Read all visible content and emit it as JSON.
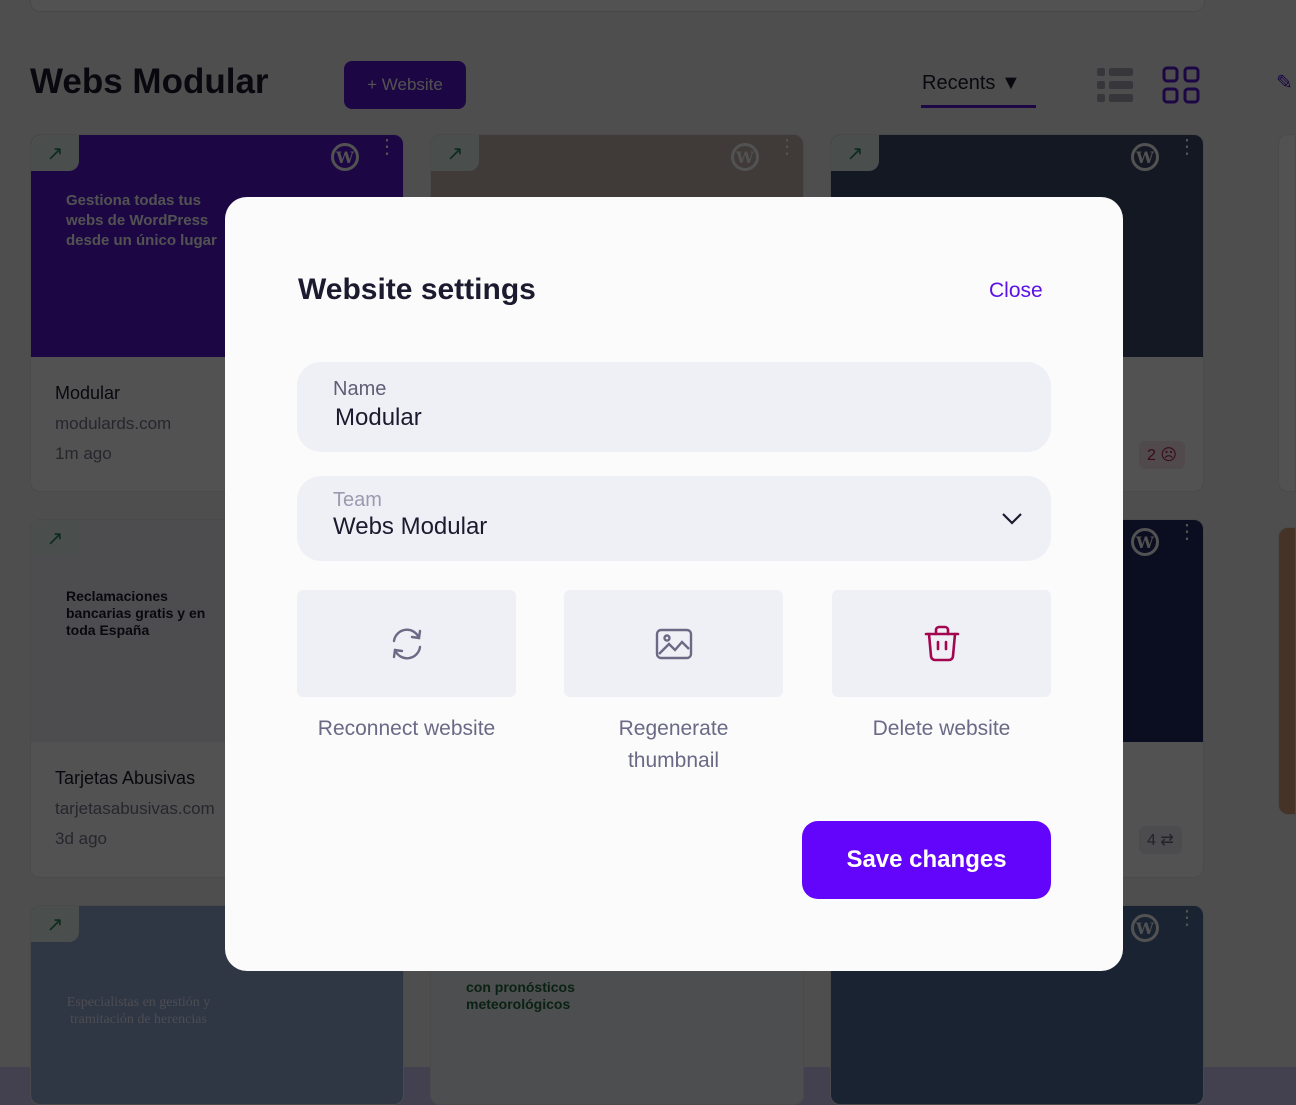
{
  "header": {
    "title": "Webs Modular",
    "add_button": "+ Website",
    "sort_label": "Recents",
    "sort_icon": "caret-down-icon"
  },
  "cards": [
    {
      "name": "Modular",
      "url": "modulards.com",
      "time": "1m ago",
      "thumb_text": "Gestiona todas tus webs de WordPress desde un único lugar",
      "thumb_color": "#5b12e8"
    },
    {
      "name": "",
      "url": "",
      "time": "",
      "thumb_text": "",
      "thumb_color": "#c9b8b0"
    },
    {
      "name": "",
      "url": "",
      "time": "",
      "thumb_text": "",
      "thumb_color": "#3a4a70",
      "badge": "2"
    },
    {
      "name": "Tarjetas Abusivas",
      "url": "tarjetasabusivas.com",
      "time": "3d ago",
      "thumb_text": "Reclamaciones bancarias gratis y en toda España",
      "thumb_color": "#f1f1f6"
    },
    {
      "name": "",
      "url": "",
      "time": "",
      "thumb_text": "",
      "thumb_color": "#1e2a6a",
      "badge": "4"
    },
    {
      "name": "",
      "url": "",
      "time": "",
      "thumb_text": "Especialistas en gestión y tramitación de herencias",
      "thumb_color": "#8fa8d8"
    },
    {
      "name": "",
      "url": "",
      "time": "",
      "thumb_text": "con pronósticos meteorológicos",
      "thumb_color": "#eef3f6"
    },
    {
      "name": "",
      "url": "",
      "time": "",
      "thumb_text": "",
      "thumb_color": "#4d6da0"
    }
  ],
  "modal": {
    "title": "Website settings",
    "close": "Close",
    "name_label": "Name",
    "name_value": "Modular",
    "team_label": "Team",
    "team_value": "Webs Modular",
    "actions": [
      {
        "label": "Reconnect website",
        "icon": "refresh-icon"
      },
      {
        "label": "Regenerate thumbnail",
        "icon": "image-icon"
      },
      {
        "label": "Delete website",
        "icon": "trash-icon"
      }
    ],
    "save": "Save changes"
  },
  "colors": {
    "accent": "#6305fa",
    "danger": "#a3064f"
  }
}
